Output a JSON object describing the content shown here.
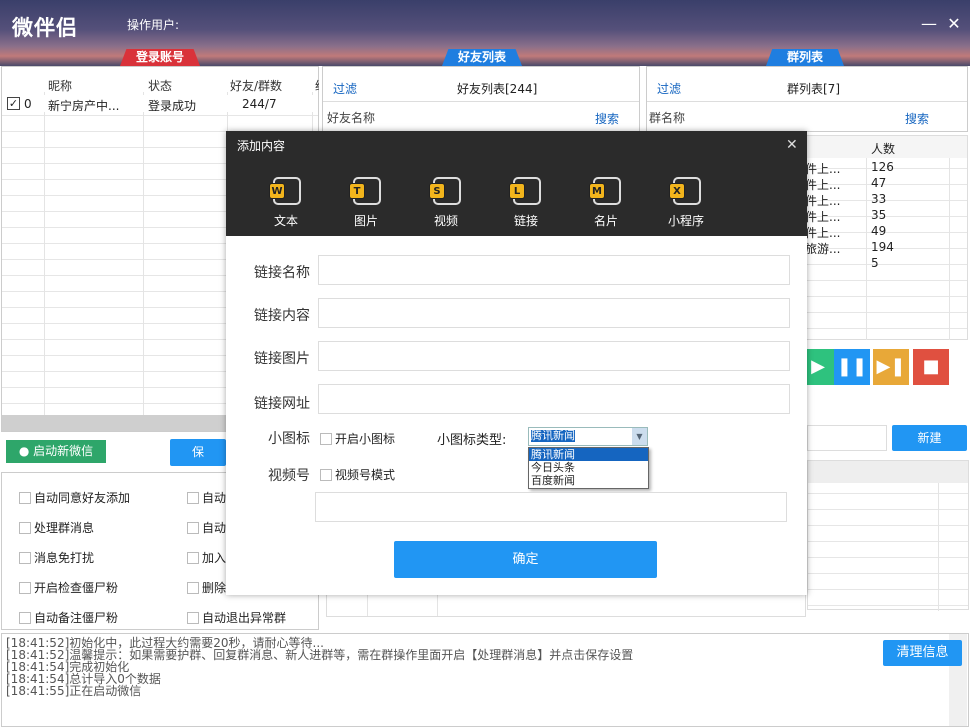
{
  "app": {
    "title": "微伴侣",
    "operator_label": "操作用户:",
    "minimize": "—",
    "close": "✕"
  },
  "tabs": {
    "login": "登录账号",
    "friends": "好友列表",
    "groups": "群列表"
  },
  "accounts": {
    "headers": [
      "昵称",
      "状态",
      "好友/群数",
      "给"
    ],
    "rows": [
      {
        "idx": "0",
        "name": "新宁房产中...",
        "status": "登录成功",
        "count": "244/7"
      }
    ]
  },
  "friends": {
    "filter": "过滤",
    "title": "好友列表[244]",
    "name_label": "好友名称",
    "search": "搜索"
  },
  "groups": {
    "filter": "过滤",
    "title": "群列表[7]",
    "name_label": "群名称",
    "search": "搜索",
    "count_header": "人数",
    "rows": [
      {
        "name": "件上...",
        "count": "126"
      },
      {
        "name": "件上...",
        "count": "47"
      },
      {
        "name": "件上...",
        "count": "33"
      },
      {
        "name": "件上...",
        "count": "35"
      },
      {
        "name": "件上...",
        "count": "49"
      },
      {
        "name": "旅游...",
        "count": "194"
      },
      {
        "name": "",
        "count": "5"
      }
    ]
  },
  "buttons": {
    "start_wechat": "启动新微信",
    "save": "保",
    "new": "新建",
    "clear": "清理信息"
  },
  "options": [
    "自动同意好友添加",
    "自动",
    "处理群消息",
    "自动",
    "消息免打扰",
    "加入",
    "开启检查僵尸粉",
    "删除",
    "自动备注僵尸粉",
    "自动退出异常群"
  ],
  "dialog": {
    "title": "添加内容",
    "close": "✕",
    "tools": [
      {
        "letter": "W",
        "label": "文本"
      },
      {
        "letter": "T",
        "label": "图片"
      },
      {
        "letter": "S",
        "label": "视频"
      },
      {
        "letter": "L",
        "label": "链接"
      },
      {
        "letter": "M",
        "label": "名片"
      },
      {
        "letter": "X",
        "label": "小程序"
      }
    ],
    "fields": {
      "name": "链接名称",
      "content": "链接内容",
      "image": "链接图片",
      "url": "链接网址"
    },
    "icon_label": "小图标",
    "icon_enable": "开启小图标",
    "icon_type_label": "小图标类型:",
    "icon_type_value": "腾讯新闻",
    "icon_options": [
      "腾讯新闻",
      "今日头条",
      "百度新闻"
    ],
    "video_label": "视频号",
    "video_mode": "视频号模式",
    "confirm": "确定"
  },
  "logs": [
    "[18:41:52]初始化中，此过程大约需要20秒，请耐心等待...",
    "[18:41:52]温馨提示：如果需要护群、回复群消息、新人进群等，需在群操作里面开启【处理群消息】并点击保存设置",
    "[18:41:54]完成初始化",
    "[18:41:54]总计导入0个数据",
    "[18:41:55]正在启动微信"
  ],
  "colors": {
    "accent": "#2196f3",
    "red_tab": "#d9323a",
    "dialog_header": "#2b2b2b",
    "tool_badge": "#f3b51c"
  }
}
